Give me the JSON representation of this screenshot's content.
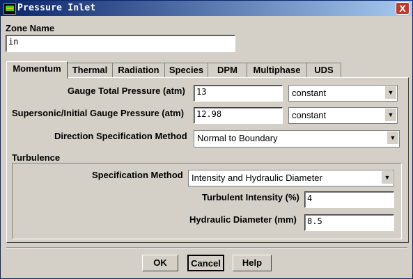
{
  "window": {
    "title": "Pressure Inlet",
    "close_label": "X"
  },
  "zone": {
    "label": "Zone Name",
    "value": "in"
  },
  "tabs": [
    {
      "label": "Momentum"
    },
    {
      "label": "Thermal"
    },
    {
      "label": "Radiation"
    },
    {
      "label": "Species"
    },
    {
      "label": "DPM"
    },
    {
      "label": "Multiphase"
    },
    {
      "label": "UDS"
    }
  ],
  "momentum": {
    "gauge_total": {
      "label": "Gauge Total Pressure (atm)",
      "value": "13",
      "method": "constant"
    },
    "supersonic": {
      "label": "Supersonic/Initial Gauge Pressure (atm)",
      "value": "12.98",
      "method": "constant"
    },
    "direction": {
      "label": "Direction Specification Method",
      "value": "Normal to Boundary"
    }
  },
  "turbulence": {
    "heading": "Turbulence",
    "spec_method": {
      "label": "Specification Method",
      "value": "Intensity and Hydraulic Diameter"
    },
    "intensity": {
      "label": "Turbulent Intensity (%)",
      "value": "4"
    },
    "hydraulic_diameter": {
      "label": "Hydraulic Diameter (mm)",
      "value": "8.5"
    }
  },
  "buttons": {
    "ok": "OK",
    "cancel": "Cancel",
    "help": "Help"
  },
  "arrow_glyph": "▼"
}
